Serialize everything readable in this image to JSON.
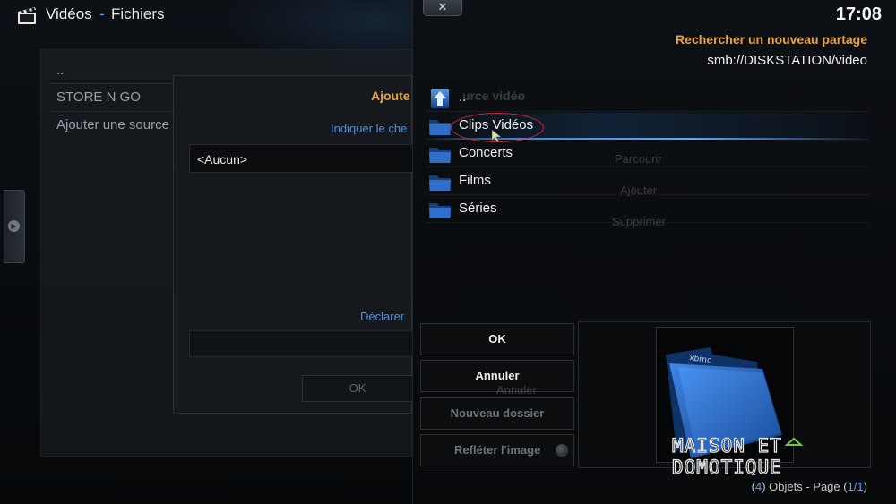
{
  "header": {
    "title": "Vidéos",
    "separator": "-",
    "subtitle": "Fichiers"
  },
  "sources": {
    "items": [
      "..",
      "STORE N GO",
      "Ajouter une source"
    ]
  },
  "add_source_dialog": {
    "title": "Ajoute",
    "hint": "Indiquer le che",
    "path_value": "<Aucun>",
    "declare_label": "Déclarer",
    "ok_label": "OK"
  },
  "ghost_labels": {
    "title_rest": "urce vidéo",
    "browse": "Parcourir",
    "add": "Ajouter",
    "remove": "Supprimer",
    "cancel": "Annuler"
  },
  "browser": {
    "close_label": "✕",
    "clock": "17:08",
    "heading": "Rechercher un nouveau partage",
    "path": "smb://DISKSTATION/video",
    "items": [
      {
        "label": "..",
        "icon": "up-arrow-icon"
      },
      {
        "label": "Clips Vidéos",
        "icon": "folder-icon",
        "selected": true
      },
      {
        "label": "Concerts",
        "icon": "folder-icon"
      },
      {
        "label": "Films",
        "icon": "folder-icon"
      },
      {
        "label": "Séries",
        "icon": "folder-icon"
      }
    ],
    "buttons": {
      "ok": "OK",
      "cancel": "Annuler",
      "new_folder": "Nouveau dossier",
      "mirror_image": "Refléter l'image"
    },
    "preview_logo": "xbmc",
    "count_prefix": "(",
    "count_objects": "4",
    "count_mid": ") Objets - Page (",
    "count_page": "1/1",
    "count_suffix": ")"
  },
  "watermark": {
    "line1": "MAISON ET",
    "line2": "DOMOTIQUE"
  },
  "colors": {
    "accent_orange": "#e8a33a",
    "accent_blue": "#4da6ff",
    "selection_circle": "#d0263a",
    "folder_blue": "#1e5fb8"
  }
}
